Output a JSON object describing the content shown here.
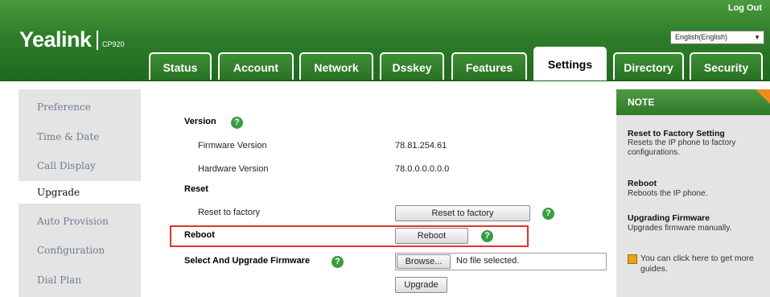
{
  "header": {
    "brand": "Yealink",
    "model": "CP920",
    "logout_label": "Log Out",
    "language": "English(English)"
  },
  "tabs": [
    {
      "label": "Status"
    },
    {
      "label": "Account"
    },
    {
      "label": "Network"
    },
    {
      "label": "Dsskey"
    },
    {
      "label": "Features"
    },
    {
      "label": "Settings",
      "active": true
    },
    {
      "label": "Directory"
    },
    {
      "label": "Security"
    }
  ],
  "sidebar": {
    "items": [
      {
        "label": "Preference"
      },
      {
        "label": "Time & Date"
      },
      {
        "label": "Call Display"
      },
      {
        "label": "Upgrade",
        "active": true
      },
      {
        "label": "Auto Provision"
      },
      {
        "label": "Configuration"
      },
      {
        "label": "Dial Plan"
      }
    ]
  },
  "main": {
    "version_title": "Version",
    "firmware_label": "Firmware Version",
    "firmware_value": "78.81.254.61",
    "hardware_label": "Hardware Version",
    "hardware_value": "78.0.0.0.0.0.0",
    "reset_title": "Reset",
    "reset_label": "Reset to factory",
    "reset_button": "Reset to factory",
    "reboot_title": "Reboot",
    "reboot_button": "Reboot",
    "upgrade_title": "Select And Upgrade Firmware",
    "browse_button": "Browse...",
    "file_status": "No file selected.",
    "upgrade_button": "Upgrade",
    "help_glyph": "?"
  },
  "note": {
    "title": "NOTE",
    "items": [
      {
        "heading": "Reset to Factory Setting",
        "text": "Resets the IP phone to factory configurations."
      },
      {
        "heading": "Reboot",
        "text": "Reboots the IP phone."
      },
      {
        "heading": "Upgrading Firmware",
        "text": "Upgrades firmware manually."
      }
    ],
    "guide_text": "You can click here to get more guides."
  },
  "colors": {
    "brand_green": "#2f7d2a",
    "help_green": "#3a9d43",
    "highlight_red": "#e0332c",
    "note_corner_orange": "#f08a1e",
    "side_link": "#6b7e8f"
  },
  "icons": [
    "help-icon",
    "dropdown-arrow-icon",
    "guide-book-icon"
  ]
}
